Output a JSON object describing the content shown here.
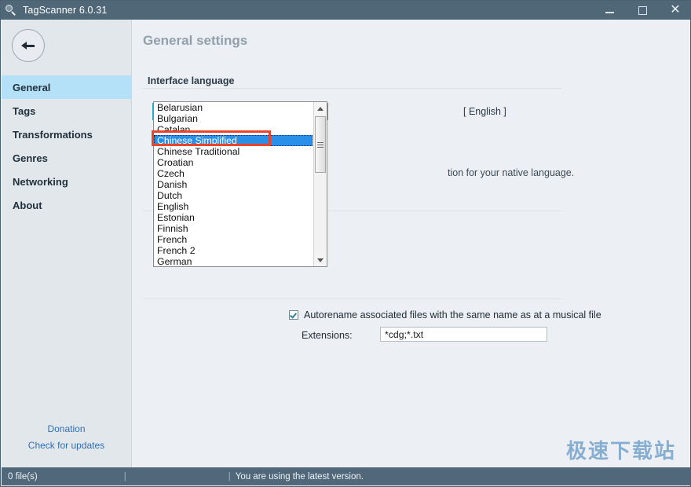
{
  "window": {
    "title": "TagScanner 6.0.31",
    "icon": "magnifier-icon",
    "minimize_label": "Minimize",
    "maximize_label": "Maximize",
    "close_label": "Close"
  },
  "sidebar": {
    "back_label": "Back",
    "items": [
      {
        "label": "General",
        "active": true
      },
      {
        "label": "Tags",
        "active": false
      },
      {
        "label": "Transformations",
        "active": false
      },
      {
        "label": "Genres",
        "active": false
      },
      {
        "label": "Networking",
        "active": false
      },
      {
        "label": "About",
        "active": false
      }
    ],
    "footer_links": [
      {
        "label": "Donation"
      },
      {
        "label": "Check for updates"
      }
    ]
  },
  "content": {
    "page_title": "General settings",
    "section_title": "Interface language",
    "language_combo": {
      "value": "English",
      "state": "open",
      "arrow": "chevron-up-icon"
    },
    "language_code": "[ English ]",
    "help_text": "tion for your native language.",
    "dropdown_options": [
      "Belarusian",
      "Bulgarian",
      "Catalan",
      "Chinese Simplified",
      "Chinese Traditional",
      "Croatian",
      "Czech",
      "Danish",
      "Dutch",
      "English",
      "Estonian",
      "Finnish",
      "French",
      "French 2",
      "German"
    ],
    "dropdown_selected": "Chinese Simplified",
    "autorename": {
      "checked": true,
      "label": "Autorename associated files with the same name as at a musical file"
    },
    "extensions": {
      "label": "Extensions:",
      "value": "*cdg;*.txt",
      "placeholder": ""
    }
  },
  "watermark": "极速下载站",
  "statusbar": {
    "files": "0 file(s)",
    "separator1": "|",
    "separator2": "|",
    "message": "You are using the latest version."
  },
  "colors": {
    "titlebar": "#4f6777",
    "sidebar": "#e2e7ec",
    "content": "#eceff3",
    "active_nav": "#b5e1f8",
    "selection": "#2a8fe8",
    "highlight_box": "#e8452c",
    "link": "#2f6fb5",
    "statusbar": "#50687a",
    "combo_focus": "#2da3b8"
  }
}
